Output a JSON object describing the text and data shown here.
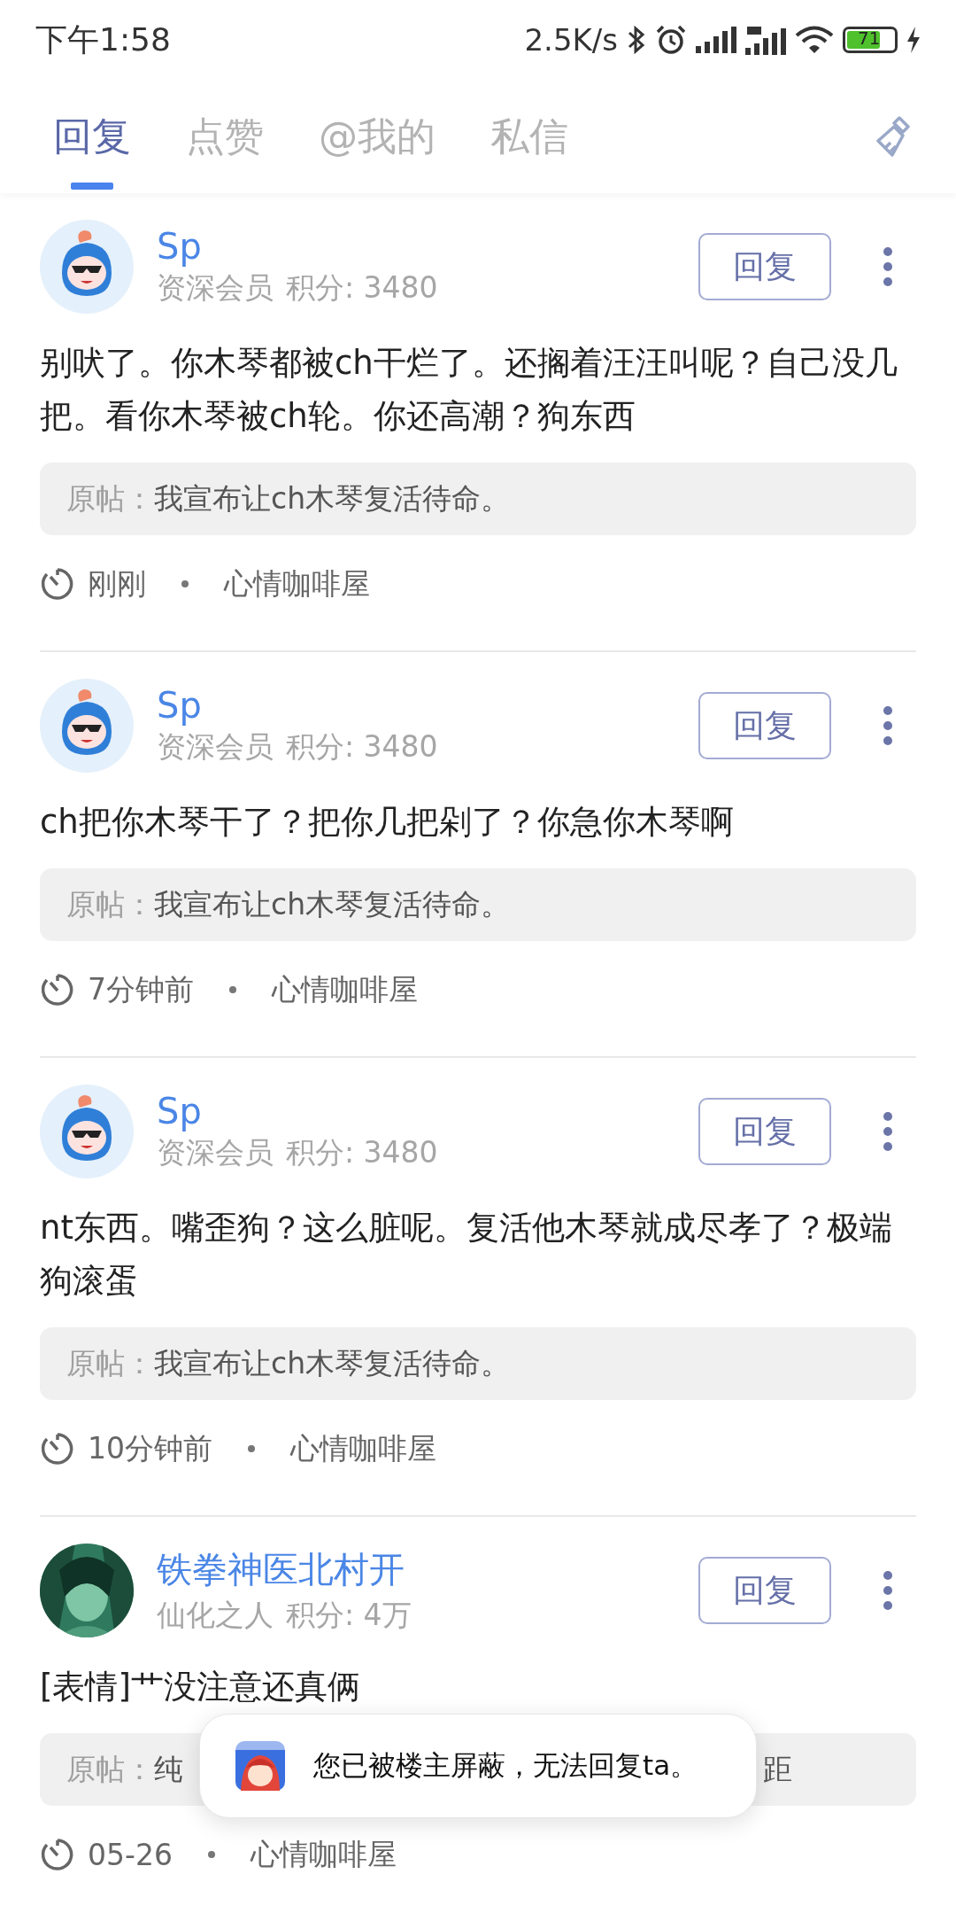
{
  "status_bar": {
    "time": "下午1:58",
    "speed": "2.5K/s",
    "battery": "71"
  },
  "tabs": [
    {
      "label": "回复",
      "selected": true
    },
    {
      "label": "点赞",
      "selected": false
    },
    {
      "label": "@我的",
      "selected": false
    },
    {
      "label": "私信",
      "selected": false
    }
  ],
  "replies": [
    {
      "avatar": {
        "kind": "mascot"
      },
      "name": "Sp",
      "rank": "资深会员",
      "score": "积分: 3480",
      "button": "回复",
      "text": "别吠了。你木琴都被ch干烂了。还搁着汪汪叫呢？自己没几把。看你木琴被ch轮。你还高潮？狗东西",
      "quote_label": "原帖：",
      "quote": "我宣布让ch木琴复活待命。",
      "time": "刚刚",
      "forum": "心情咖啡屋"
    },
    {
      "avatar": {
        "kind": "mascot"
      },
      "name": "Sp",
      "rank": "资深会员",
      "score": "积分: 3480",
      "button": "回复",
      "text": "ch把你木琴干了？把你几把剁了？你急你木琴啊",
      "quote_label": "原帖：",
      "quote": "我宣布让ch木琴复活待命。",
      "time": "7分钟前",
      "forum": "心情咖啡屋"
    },
    {
      "avatar": {
        "kind": "mascot"
      },
      "name": "Sp",
      "rank": "资深会员",
      "score": "积分: 3480",
      "button": "回复",
      "text": "nt东西。嘴歪狗？这么脏呢。复活他木琴就成尽孝了？极端狗滚蛋",
      "quote_label": "原帖：",
      "quote": "我宣布让ch木琴复活待命。",
      "time": "10分钟前",
      "forum": "心情咖啡屋"
    },
    {
      "name": "铁拳神医北村开",
      "rank": "仙化之人",
      "score": "积分: 4万",
      "button": "回复",
      "text": "[表情]艹没注意还真俩",
      "quote_label": "原帖：",
      "quote": "纯",
      "quote_end": "距",
      "time": "05-26",
      "forum": "心情咖啡屋"
    }
  ],
  "toast": {
    "text": "您已被楼主屏蔽，无法回复ta。"
  }
}
